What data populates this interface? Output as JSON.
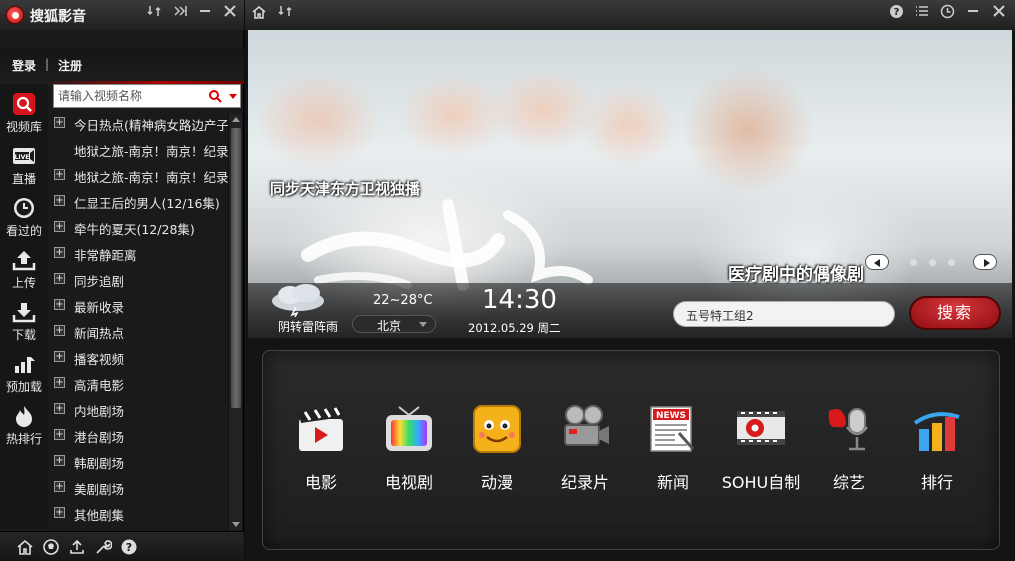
{
  "app": {
    "title": "搜狐影音",
    "login": "登录",
    "register": "注册",
    "separator": "|"
  },
  "search": {
    "placeholder": "请输入视频名称"
  },
  "left_nav": [
    {
      "label": "视频库",
      "icon": "search-icon"
    },
    {
      "label": "直播",
      "icon": "live-tv-icon"
    },
    {
      "label": "看过的",
      "icon": "clock-icon"
    },
    {
      "label": "上传",
      "icon": "upload-icon"
    },
    {
      "label": "下载",
      "icon": "download-icon"
    },
    {
      "label": "预加载",
      "icon": "preload-bars-icon"
    },
    {
      "label": "热排行",
      "icon": "hot-rank-icon"
    }
  ],
  "categories": [
    {
      "label": "今日热点(精神病女路边产子",
      "expandable": true
    },
    {
      "label": "地狱之旅-南京！南京！纪录",
      "expandable": false
    },
    {
      "label": "地狱之旅-南京！南京！纪录",
      "expandable": true
    },
    {
      "label": "仁显王后的男人(12/16集)",
      "expandable": true
    },
    {
      "label": "牵牛的夏天(12/28集)",
      "expandable": true
    },
    {
      "label": "非常静距离",
      "expandable": true
    },
    {
      "label": "同步追剧",
      "expandable": true
    },
    {
      "label": "最新收录",
      "expandable": true
    },
    {
      "label": "新闻热点",
      "expandable": true
    },
    {
      "label": "播客视频",
      "expandable": true
    },
    {
      "label": "高清电影",
      "expandable": true
    },
    {
      "label": "内地剧场",
      "expandable": true
    },
    {
      "label": "港台剧场",
      "expandable": true
    },
    {
      "label": "韩剧剧场",
      "expandable": true
    },
    {
      "label": "美剧剧场",
      "expandable": true
    },
    {
      "label": "其他剧集",
      "expandable": true
    }
  ],
  "bottom_icons": [
    "home-icon",
    "soccer-ball-icon",
    "upload-icon",
    "wrench-icon",
    "help-icon"
  ],
  "banner": {
    "slogan": "同步天津东方卫视独播",
    "caption": "医疗剧中的偶像剧",
    "dots": 3
  },
  "info": {
    "temperature": "22~28°C",
    "weather": "阴转雷阵雨",
    "city": "北京",
    "time": "14:30",
    "date": "2012.05.29 周二",
    "search_value": "五号特工组2",
    "search_button": "搜索"
  },
  "tiles": [
    {
      "label": "电影",
      "icon": "clapperboard-icon"
    },
    {
      "label": "电视剧",
      "icon": "tv-icon"
    },
    {
      "label": "动漫",
      "icon": "cartoon-face-icon"
    },
    {
      "label": "纪录片",
      "icon": "film-camera-icon"
    },
    {
      "label": "新闻",
      "icon": "news-icon"
    },
    {
      "label": "SOHU自制",
      "icon": "sohu-film-icon"
    },
    {
      "label": "综艺",
      "icon": "microphone-icon"
    },
    {
      "label": "排行",
      "icon": "ranking-bars-icon"
    }
  ],
  "colors": {
    "accent_red": "#c8101a",
    "panel_dark": "#1a1a1a"
  }
}
